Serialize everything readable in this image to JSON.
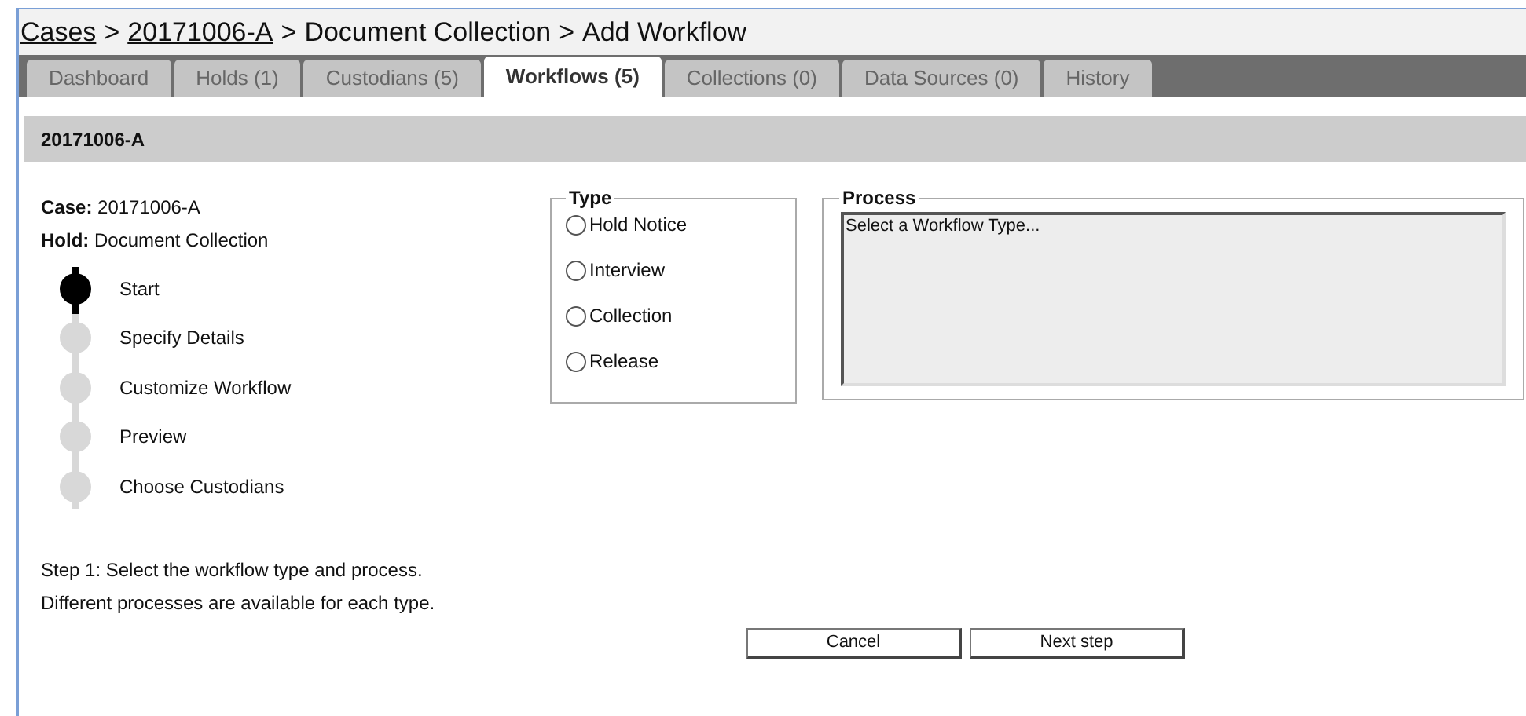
{
  "breadcrumb": [
    {
      "label": "Cases",
      "link": true
    },
    {
      "label": "20171006-A",
      "link": true
    },
    {
      "label": "Document Collection",
      "link": false
    },
    {
      "label": "Add Workflow",
      "link": false
    }
  ],
  "breadcrumb_separator": ">",
  "tabs": [
    {
      "label": "Dashboard",
      "selected": false
    },
    {
      "label": "Holds (1)",
      "selected": false
    },
    {
      "label": "Custodians (5)",
      "selected": false
    },
    {
      "label": "Workflows (5)",
      "selected": true
    },
    {
      "label": "Collections (0)",
      "selected": false
    },
    {
      "label": "Data Sources (0)",
      "selected": false
    },
    {
      "label": "History",
      "selected": false
    }
  ],
  "panel_title": "20171006-A",
  "info": [
    {
      "label": "Case:",
      "value": "20171006-A"
    },
    {
      "label": "Hold:",
      "value": "Document Collection"
    }
  ],
  "steps": [
    {
      "label": "Start",
      "selected": true
    },
    {
      "label": "Specify Details",
      "selected": false
    },
    {
      "label": "Customize Workflow",
      "selected": false
    },
    {
      "label": "Preview",
      "selected": false
    },
    {
      "label": "Choose Custodians",
      "selected": false
    }
  ],
  "type_group": {
    "legend": "Type",
    "options": [
      {
        "label": "Hold Notice",
        "selected": false
      },
      {
        "label": "Interview",
        "selected": false
      },
      {
        "label": "Collection",
        "selected": false
      },
      {
        "label": "Release",
        "selected": false
      }
    ]
  },
  "process_group": {
    "legend": "Process",
    "message": "Select a Workflow Type..."
  },
  "instructions": [
    "Step 1: Select the workflow type and process.",
    "Different processes are available for each type."
  ],
  "buttons": [
    "Cancel",
    "Next step"
  ]
}
